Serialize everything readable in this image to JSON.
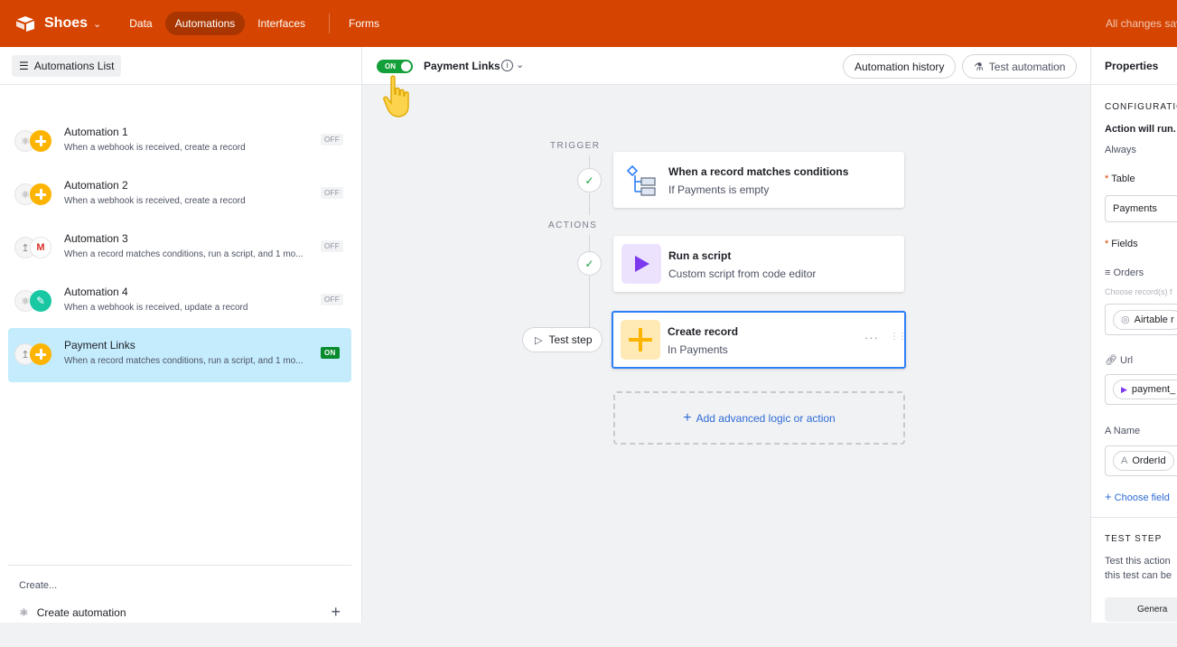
{
  "topbar": {
    "base_name": "Shoes",
    "nav": [
      "Data",
      "Automations",
      "Interfaces",
      "Forms"
    ],
    "active_nav": "Automations",
    "status": "All changes saved",
    "colors": {
      "bar": "#d54400",
      "active_pill": "#a93600"
    }
  },
  "sidebar": {
    "list_button": "Automations List",
    "automations": [
      {
        "name": "Automation 1",
        "desc": "When a webhook is received, create a record",
        "status": "OFF",
        "icons": [
          "webhook-icon",
          "plus-icon"
        ]
      },
      {
        "name": "Automation 2",
        "desc": "When a webhook is received, create a record",
        "status": "OFF",
        "icons": [
          "webhook-icon",
          "plus-icon"
        ]
      },
      {
        "name": "Automation 3",
        "desc": "When a record matches conditions, run a script, and 1 mo...",
        "status": "OFF",
        "icons": [
          "condition-icon",
          "gmail-icon"
        ]
      },
      {
        "name": "Automation 4",
        "desc": "When a webhook is received, update a record",
        "status": "OFF",
        "icons": [
          "webhook-icon",
          "pencil-icon"
        ]
      },
      {
        "name": "Payment Links",
        "desc": "When a record matches conditions, run a script, and 1 mo...",
        "status": "ON",
        "icons": [
          "condition-icon",
          "plus-icon"
        ],
        "selected": true
      }
    ],
    "create_label": "Create...",
    "create_automation": "Create automation"
  },
  "editor": {
    "toggle_label": "ON",
    "title": "Payment Links",
    "history_button": "Automation history",
    "test_button": "Test automation",
    "trigger_label": "TRIGGER",
    "actions_label": "ACTIONS",
    "trigger": {
      "title": "When a record matches conditions",
      "sub": "If Payments is empty"
    },
    "actions": [
      {
        "title": "Run a script",
        "sub": "Custom script from code editor"
      },
      {
        "title": "Create record",
        "sub": "In Payments"
      }
    ],
    "test_step": "Test step",
    "add_logic": "Add advanced logic or action",
    "colors": {
      "toggle": "#139f3a",
      "selected_border": "#2d7ff9",
      "script": "#7c39ed",
      "create": "#fcb400"
    }
  },
  "properties": {
    "header": "Properties",
    "config_label": "CONFIGURATIO",
    "action_run": "Action will run.",
    "always": "Always",
    "table_label": "Table",
    "table_value": "Payments",
    "fields_label": "Fields",
    "orders_label": "Orders",
    "orders_hint": "Choose record(s) f",
    "orders_value": "Airtable r",
    "url_label": "Url",
    "url_value": "payment_",
    "name_label": "Name",
    "name_value": "OrderId",
    "choose_field": "Choose field",
    "test_step_label": "TEST STEP",
    "test_desc_1": "Test this action",
    "test_desc_2": "this test can be",
    "generate": "Genera"
  }
}
